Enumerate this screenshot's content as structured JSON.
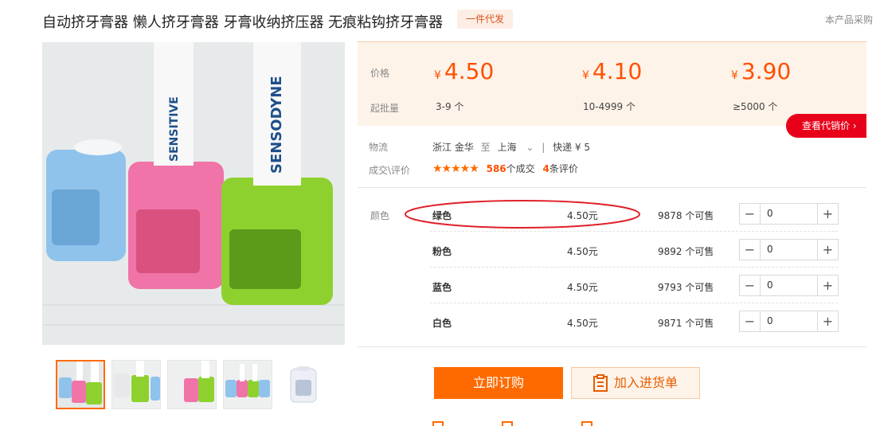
{
  "header": {
    "title": "自动挤牙膏器 懒人挤牙膏器 牙膏收纳挤压器 无痕粘钩挤牙膏器",
    "badge": "一件代发",
    "notice": "本产品采购"
  },
  "gallery": {
    "thumbnail_count": 5,
    "active_thumbnail": 0
  },
  "pricing": {
    "price_label": "价格",
    "moq_label": "起批量",
    "currency": "¥",
    "tiers": [
      {
        "price": "4.50",
        "range": "3-9 个"
      },
      {
        "price": "4.10",
        "range": "10-4999 个"
      },
      {
        "price": "3.90",
        "range": "≥5000 个"
      }
    ],
    "agent_button": "查看代销价"
  },
  "logistics": {
    "label": "物流",
    "from": "浙江 金华",
    "to_word": "至",
    "to": "上海",
    "shipping": "快递 ¥ 5"
  },
  "reviews": {
    "label": "成交\\评价",
    "rating_stars": 4.5,
    "stars_glyph": "★★★★★",
    "deals_count": "586",
    "deals_text": "个成交",
    "review_count": "4",
    "review_text": "条评价"
  },
  "sku": {
    "label": "颜色",
    "rows": [
      {
        "name": "绿色",
        "price": "4.50元",
        "stock": "9878 个可售",
        "qty": "0"
      },
      {
        "name": "粉色",
        "price": "4.50元",
        "stock": "9892 个可售",
        "qty": "0"
      },
      {
        "name": "蓝色",
        "price": "4.50元",
        "stock": "9793 个可售",
        "qty": "0"
      },
      {
        "name": "白色",
        "price": "4.50元",
        "stock": "9871 个可售",
        "qty": "0"
      }
    ]
  },
  "actions": {
    "order_button": "立即订购",
    "cart_button": "加入进货单"
  },
  "colors": {
    "accent": "#ff6a00",
    "price": "#ff5000",
    "agent_red": "#e8001a",
    "annotation_red": "#e0202a",
    "price_bg": "#fef3e9"
  }
}
